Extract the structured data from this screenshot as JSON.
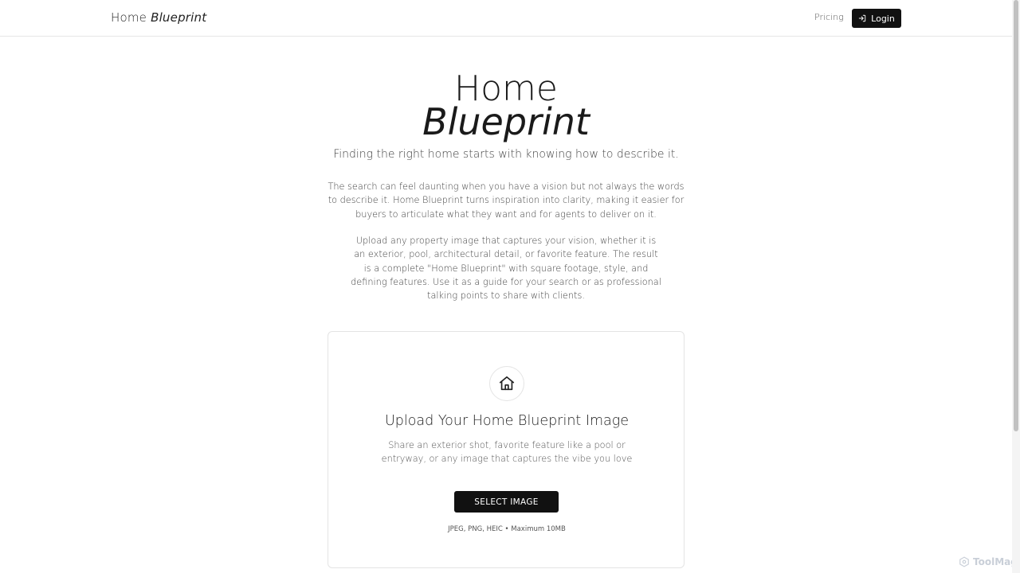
{
  "header": {
    "brand_plain": "Home",
    "brand_italic": "Blueprint",
    "nav_pricing": "Pricing",
    "login_label": "Login"
  },
  "hero": {
    "title_line1": "Home",
    "title_line2": "Blueprint",
    "tagline": "Finding the right home starts with knowing how to describe it.",
    "paragraph1": "The search can feel daunting when you have a vision but not always the words to describe it. Home Blueprint turns inspiration into clarity, making it easier for buyers to articulate what they want and for agents to deliver on it.",
    "paragraph2": "Upload any property image that captures your vision, whether it is an exterior, pool, architectural detail, or favorite feature. The result is a complete \"Home Blueprint\" with square footage, style, and defining features. Use it as a guide for your search or as professional talking points to share with clients."
  },
  "upload": {
    "icon": "home-icon",
    "title": "Upload Your Home Blueprint Image",
    "description": "Share an exterior shot, favorite feature like a pool or entryway, or any image that captures the vibe you love",
    "button_label": "SELECT IMAGE",
    "formats": "JPEG, PNG, HEIC • Maximum 10MB"
  },
  "watermark": {
    "label": "ToolMage"
  },
  "colors": {
    "primary_button": "#111111",
    "border": "#e4e4e4",
    "text": "#222222"
  }
}
